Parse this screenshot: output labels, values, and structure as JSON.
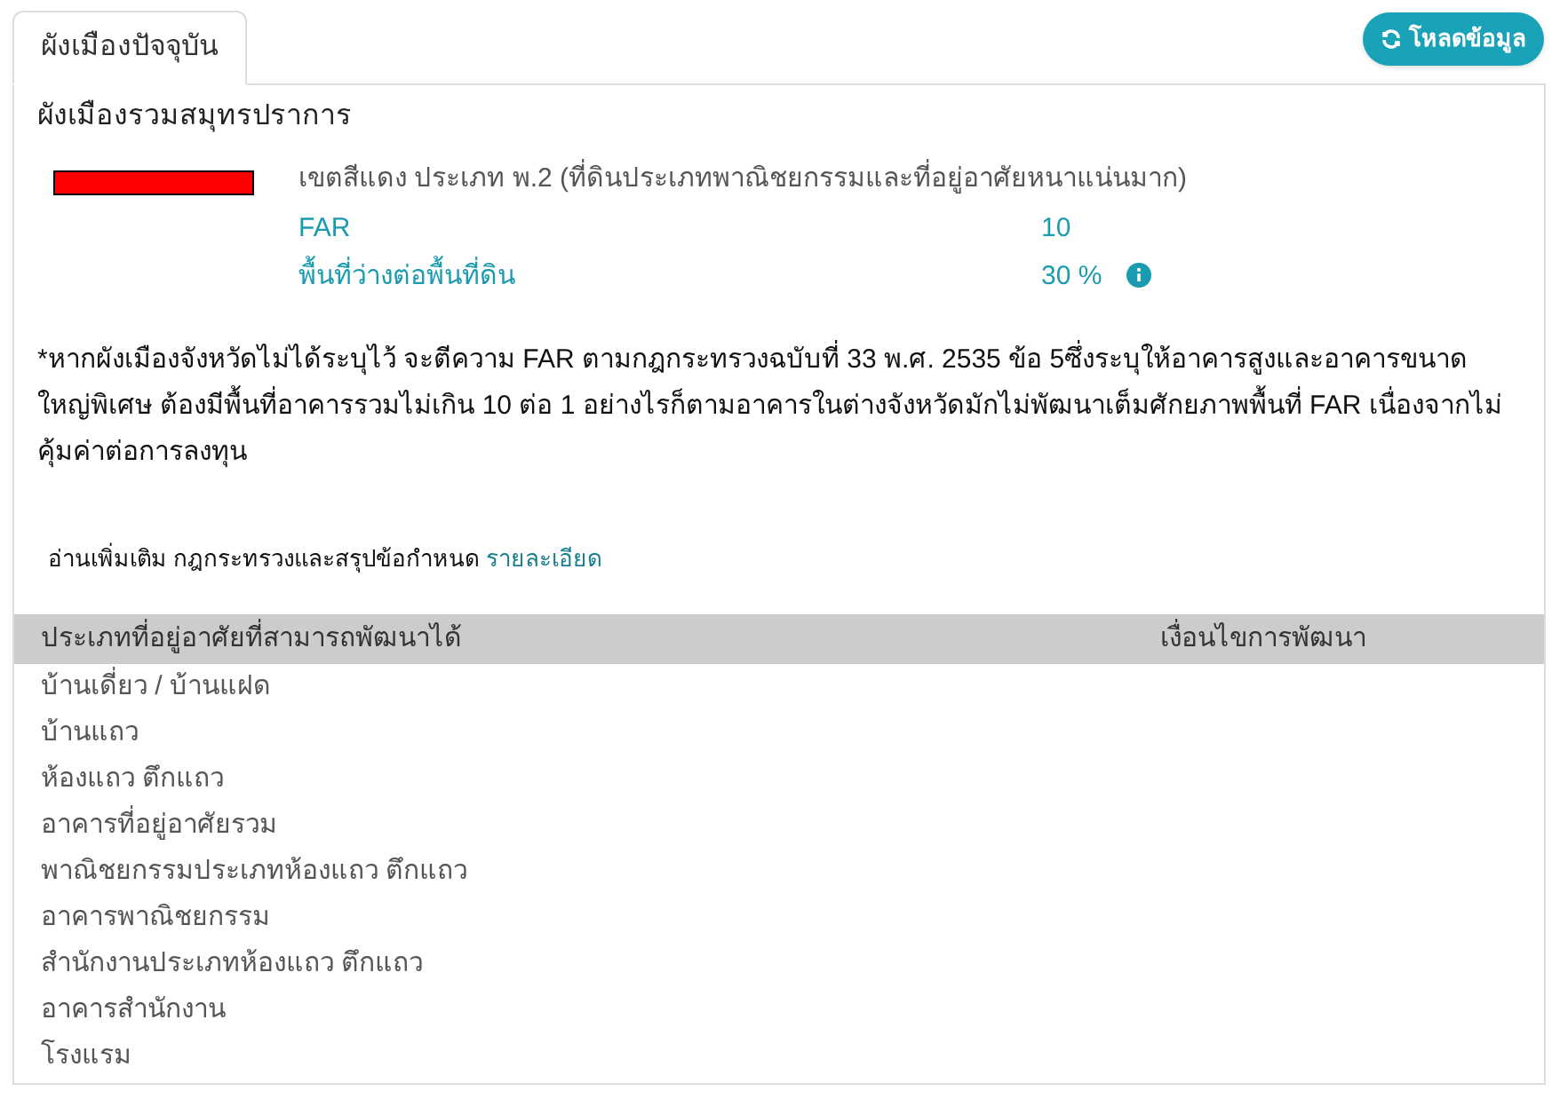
{
  "tabs": [
    {
      "label": "ผังเมืองปัจจุบัน",
      "selected": true
    }
  ],
  "reload_button": {
    "label": "โหลดข้อมูล"
  },
  "plan_title": "ผังเมืองรวมสมุทรปราการ",
  "zone": {
    "color": "#ff0000",
    "description": "เขตสีแดง ประเภท พ.2 (ที่ดินประเภทพาณิชยกรรมและที่อยู่อาศัยหนาแน่นมาก)",
    "metrics": [
      {
        "label": "FAR",
        "value": "10",
        "info": false
      },
      {
        "label": "พื้นที่ว่างต่อพื้นที่ดิน",
        "value": "30 %",
        "info": true
      }
    ]
  },
  "note": "*หากผังเมืองจังหวัดไม่ได้ระบุไว้ จะตีความ FAR ตามกฎกระทรวงฉบับที่ 33 พ.ศ. 2535 ข้อ 5ซึ่งระบุให้อาคารสูงและอาคารขนาดใหญ่พิเศษ ต้องมีพื้นที่อาคารรวมไม่เกิน 10 ต่อ 1 อย่างไรก็ตามอาคารในต่างจังหวัดมักไม่พัฒนาเต็มศักยภาพพื้นที่ FAR เนื่องจากไม่คุ้มค่าต่อการลงทุน",
  "read_more": {
    "text": "อ่านเพิ่มเติม กฎกระทรวงและสรุปข้อกำหนด",
    "link": "รายละเอียด"
  },
  "table": {
    "columns": [
      "ประเภทที่อยู่อาศัยที่สามารถพัฒนาได้",
      "เงื่อนไขการพัฒนา"
    ],
    "rows": [
      "บ้านเดี่ยว / บ้านแฝด",
      "บ้านแถว",
      "ห้องแถว ตึกแถว",
      "อาคารที่อยู่อาศัยรวม",
      "พาณิชยกรรมประเภทห้องแถว ตึกแถว",
      "อาคารพาณิชยกรรม",
      "สำนักงานประเภทห้องแถว ตึกแถว",
      "อาคารสำนักงาน",
      "โรงแรม"
    ]
  }
}
